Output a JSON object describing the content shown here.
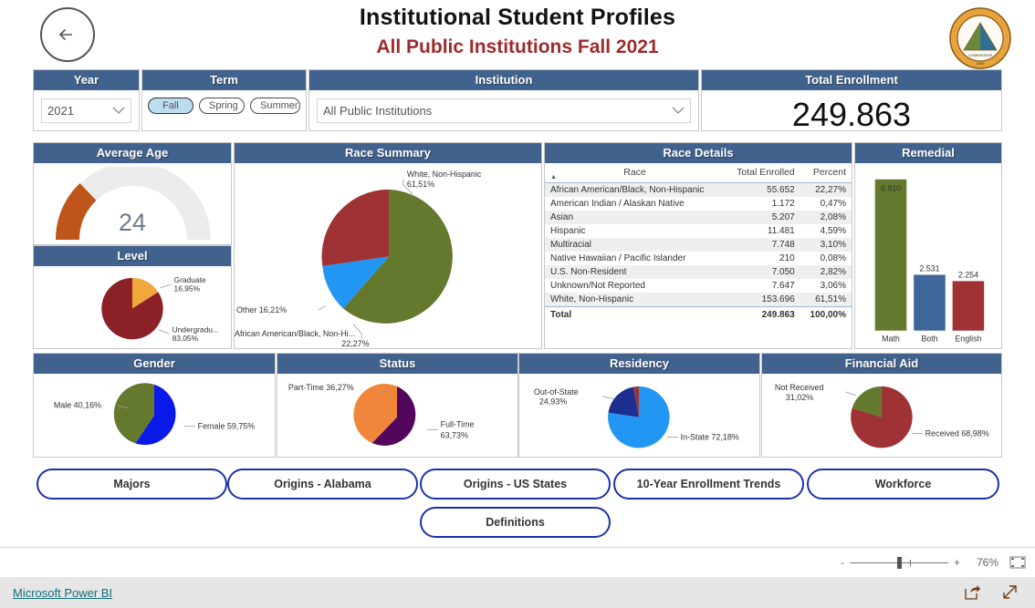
{
  "header": {
    "back_label": "back-arrow",
    "title": "Institutional Student Profiles",
    "subtitle": "All Public Institutions Fall 2021",
    "logo_alt": "alabama-commission-on-higher-education-seal"
  },
  "filters": {
    "year": {
      "title": "Year",
      "value": "2021"
    },
    "term": {
      "title": "Term",
      "options": [
        "Fall",
        "Spring",
        "Summer"
      ],
      "selected": "Fall"
    },
    "institution": {
      "title": "Institution",
      "value": "All Public Institutions"
    },
    "total_enrollment": {
      "title": "Total Enrollment",
      "value": "249.863"
    }
  },
  "panels": {
    "average_age": {
      "title": "Average Age",
      "value": "24"
    },
    "level": {
      "title": "Level"
    },
    "race_summary": {
      "title": "Race Summary"
    },
    "race_details": {
      "title": "Race Details"
    },
    "remedial": {
      "title": "Remedial"
    },
    "gender": {
      "title": "Gender"
    },
    "status": {
      "title": "Status"
    },
    "residency": {
      "title": "Residency"
    },
    "financial_aid": {
      "title": "Financial Aid"
    }
  },
  "race_table": {
    "columns": [
      "Race",
      "Total Enrolled",
      "Percent"
    ],
    "rows": [
      [
        "African American/Black, Non-Hispanic",
        "55.652",
        "22,27%"
      ],
      [
        "American Indian / Alaskan Native",
        "1.172",
        "0,47%"
      ],
      [
        "Asian",
        "5.207",
        "2,08%"
      ],
      [
        "Hispanic",
        "11.481",
        "4,59%"
      ],
      [
        "Multiracial",
        "7.748",
        "3,10%"
      ],
      [
        "Native Hawaiian / Pacific Islander",
        "210",
        "0,08%"
      ],
      [
        "U.S. Non-Resident",
        "7.050",
        "2,82%"
      ],
      [
        "Unknown/Not Reported",
        "7.647",
        "3,06%"
      ],
      [
        "White, Non-Hispanic",
        "153.696",
        "61,51%"
      ]
    ],
    "total": [
      "Total",
      "249.863",
      "100,00%"
    ]
  },
  "nav_buttons": [
    "Majors",
    "Origins - Alabama",
    "Origins - US States",
    "10-Year Enrollment Trends",
    "Workforce",
    "Definitions"
  ],
  "statusbar": {
    "zoom_out": "-",
    "zoom_in": "+",
    "zoom_level": "76%",
    "fit_icon": "fit-to-page-icon"
  },
  "footer": {
    "link": "Microsoft Power BI",
    "share_icon": "share-icon",
    "fullscreen_icon": "fullscreen-icon"
  },
  "colors": {
    "header_blue": "#41628d",
    "title_red": "#9e2a2b",
    "green": "#65792e",
    "dark_red": "#9e3234",
    "blue": "#2196f3",
    "navy": "#1c2f8f",
    "orange": "#f0963c",
    "purple": "#52065c",
    "steel_blue": "#3e6698",
    "gauge_orange": "#c0551c",
    "nav_border": "#1b31a8",
    "link": "#11707a"
  },
  "chart_data": [
    {
      "type": "pie",
      "name": "race_summary",
      "title": "Race Summary",
      "labels": [
        "White, Non-Hispanic",
        "African American/Black, Non-Hi...",
        "Other"
      ],
      "label_texts": [
        "White, Non-Hispanic\n61,51%",
        "African American/Black, Non-Hi...\n22,27%",
        "Other 16,21%"
      ],
      "values": [
        61.51,
        22.27,
        16.21
      ],
      "colors": [
        "#65792e",
        "#2196f3",
        "#9e3234"
      ]
    },
    {
      "type": "pie",
      "name": "level",
      "title": "Level",
      "labels": [
        "Graduate",
        "Undergradu..."
      ],
      "label_texts": [
        "Graduate\n16,95%",
        "Undergradu...\n83,05%"
      ],
      "values": [
        16.95,
        83.05
      ],
      "colors": [
        "#f0a73c",
        "#8b2026"
      ]
    },
    {
      "type": "bar",
      "name": "remedial",
      "title": "Remedial",
      "categories": [
        "Math",
        "Both",
        "English"
      ],
      "values": [
        6910,
        2531,
        2254
      ],
      "value_labels": [
        "6.910",
        "2.531",
        "2.254"
      ],
      "colors": [
        "#65792e",
        "#3e6698",
        "#9e3234"
      ],
      "ylim": [
        0,
        6910
      ],
      "grid": false
    },
    {
      "type": "pie",
      "name": "gender",
      "title": "Gender",
      "labels": [
        "Male",
        "Female"
      ],
      "label_texts": [
        "Male 40,16%",
        "Female 59,75%"
      ],
      "values": [
        40.16,
        59.75
      ],
      "colors": [
        "#65792e",
        "#0a18e8"
      ]
    },
    {
      "type": "pie",
      "name": "status",
      "title": "Status",
      "labels": [
        "Part-Time",
        "Full-Time"
      ],
      "label_texts": [
        "Part-Time 36,27%",
        "Full-Time\n63,73%"
      ],
      "values": [
        36.27,
        63.73
      ],
      "colors": [
        "#f0863c",
        "#52065c"
      ]
    },
    {
      "type": "pie",
      "name": "residency",
      "title": "Residency",
      "labels": [
        "In-State",
        "Out-of-State",
        "Other"
      ],
      "label_texts": [
        "In-State 72,18%",
        "Out-of-State\n24,93%",
        ""
      ],
      "values": [
        72.18,
        24.93,
        2.89
      ],
      "colors": [
        "#2196f3",
        "#1c2f8f",
        "#9e3234"
      ]
    },
    {
      "type": "pie",
      "name": "financial_aid",
      "title": "Financial Aid",
      "labels": [
        "Received",
        "Not Received"
      ],
      "label_texts": [
        "Received 68,98%",
        "Not Received\n31,02%"
      ],
      "values": [
        68.98,
        31.02
      ],
      "colors": [
        "#9e3234",
        "#65792e"
      ]
    },
    {
      "type": "gauge",
      "name": "average_age",
      "title": "Average Age",
      "value": 24,
      "value_label": "24",
      "color": "#c0551c"
    }
  ]
}
